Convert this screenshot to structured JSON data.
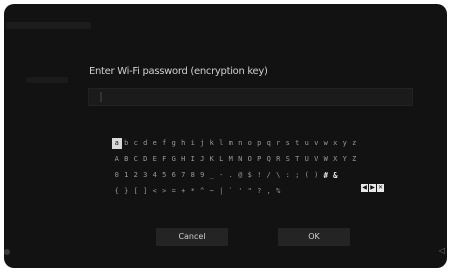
{
  "prompt": "Enter Wi-Fi password (encryption key)",
  "password_field": {
    "value": ""
  },
  "keyboard": {
    "rows": [
      [
        "a",
        "b",
        "c",
        "d",
        "e",
        "f",
        "g",
        "h",
        "i",
        "j",
        "k",
        "l",
        "m",
        "n",
        "o",
        "p",
        "q",
        "r",
        "s",
        "t",
        "u",
        "v",
        "w",
        "x",
        "y",
        "z"
      ],
      [
        "A",
        "B",
        "C",
        "D",
        "E",
        "F",
        "G",
        "H",
        "I",
        "J",
        "K",
        "L",
        "M",
        "N",
        "O",
        "P",
        "Q",
        "R",
        "S",
        "T",
        "U",
        "V",
        "W",
        "X",
        "Y",
        "Z"
      ],
      [
        "0",
        "1",
        "2",
        "3",
        "4",
        "5",
        "6",
        "7",
        "8",
        "9",
        "_",
        "-",
        ".",
        "@",
        "$",
        "!",
        "/",
        "\\",
        ":",
        ";",
        "(",
        ")",
        "#",
        "&"
      ],
      [
        "{",
        "}",
        "[",
        "]",
        "<",
        ">",
        "=",
        "+",
        "*",
        "^",
        "~",
        "|",
        "`",
        "'",
        "\"",
        "?",
        ",",
        "%"
      ]
    ],
    "selected_key": "a",
    "special_keys": [
      "◀",
      "▶",
      "✕"
    ]
  },
  "buttons": {
    "cancel": "Cancel",
    "ok": "OK"
  },
  "status_right": "◁"
}
